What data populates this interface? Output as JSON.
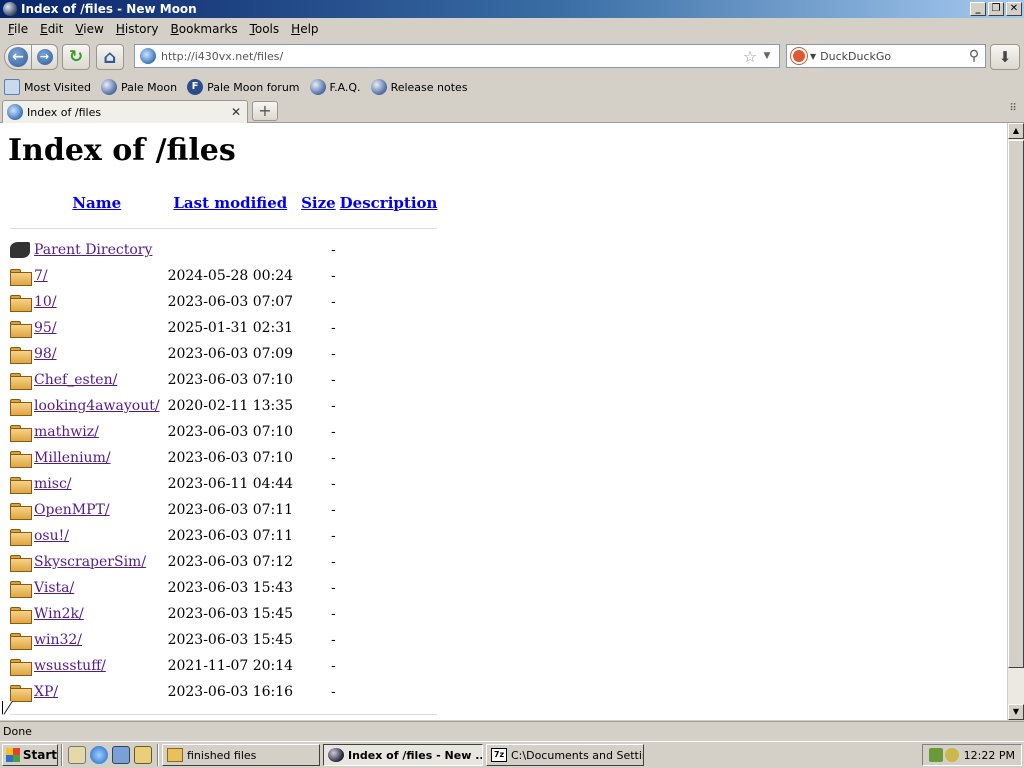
{
  "window": {
    "title": "Index of /files - New Moon",
    "minimize": "_",
    "restore": "❐",
    "close": "✕"
  },
  "menu": {
    "items": [
      {
        "acc": "F",
        "rest": "ile"
      },
      {
        "acc": "E",
        "rest": "dit"
      },
      {
        "acc": "V",
        "rest": "iew"
      },
      {
        "acc": "H",
        "rest": "istory"
      },
      {
        "acc": "B",
        "rest": "ookmarks"
      },
      {
        "acc": "T",
        "rest": "ools"
      },
      {
        "acc": "H",
        "rest": "elp"
      }
    ]
  },
  "nav": {
    "back_glyph": "←",
    "forward_glyph": "→",
    "reload_glyph": "↻",
    "home_glyph": "⌂",
    "url": "http://i430vx.net/files/",
    "star_glyph": "☆",
    "dropdown_glyph": "▼",
    "search_placeholder": "DuckDuckGo",
    "search_engine_drop": "▼",
    "search_glyph": "⚲",
    "download_glyph": "⬇"
  },
  "bookmarks": [
    {
      "label": "Most Visited",
      "icon": "most-visited-icon"
    },
    {
      "label": "Pale Moon",
      "icon": "pale-moon-icon"
    },
    {
      "label": "Pale Moon forum",
      "icon": "forum-icon"
    },
    {
      "label": "F.A.Q.",
      "icon": "pale-moon-icon"
    },
    {
      "label": "Release notes",
      "icon": "pale-moon-icon"
    }
  ],
  "tabs": {
    "active_label": "Index of /files",
    "close_glyph": "✕",
    "new_tab_glyph": "+",
    "list_glyph": "⠿"
  },
  "page": {
    "title": "Index of /files",
    "columns": {
      "name": "Name",
      "modified": "Last modified",
      "size": "Size",
      "description": "Description"
    },
    "parent": {
      "name": "Parent Directory",
      "size": "-"
    },
    "rows": [
      {
        "name": "7/",
        "modified": "2024-05-28 00:24",
        "size": "-"
      },
      {
        "name": "10/",
        "modified": "2023-06-03 07:07",
        "size": "-"
      },
      {
        "name": "95/",
        "modified": "2025-01-31 02:31",
        "size": "-"
      },
      {
        "name": "98/",
        "modified": "2023-06-03 07:09",
        "size": "-"
      },
      {
        "name": "Chef_esten/",
        "modified": "2023-06-03 07:10",
        "size": "-"
      },
      {
        "name": "looking4awayout/",
        "modified": "2020-02-11 13:35",
        "size": "-"
      },
      {
        "name": "mathwiz/",
        "modified": "2023-06-03 07:10",
        "size": "-"
      },
      {
        "name": "Millenium/",
        "modified": "2023-06-03 07:10",
        "size": "-"
      },
      {
        "name": "misc/",
        "modified": "2023-06-11 04:44",
        "size": "-"
      },
      {
        "name": "OpenMPT/",
        "modified": "2023-06-03 07:11",
        "size": "-"
      },
      {
        "name": "osu!/",
        "modified": "2023-06-03 07:11",
        "size": "-"
      },
      {
        "name": "SkyscraperSim/",
        "modified": "2023-06-03 07:12",
        "size": "-"
      },
      {
        "name": "Vista/",
        "modified": "2023-06-03 15:43",
        "size": "-"
      },
      {
        "name": "Win2k/",
        "modified": "2023-06-03 15:45",
        "size": "-"
      },
      {
        "name": "win32/",
        "modified": "2023-06-03 15:45",
        "size": "-"
      },
      {
        "name": "wsusstuff/",
        "modified": "2021-11-07 20:14",
        "size": "-"
      },
      {
        "name": "XP/",
        "modified": "2023-06-03 16:16",
        "size": "-"
      }
    ]
  },
  "scrollbar": {
    "up": "▲",
    "down": "▼"
  },
  "status": {
    "text": "Done"
  },
  "taskbar": {
    "start_label": "Start",
    "tasks": [
      {
        "label": "finished files",
        "icon": "folder",
        "active": false,
        "width": 158
      },
      {
        "label": "Index of /files - New ...",
        "icon": "moon",
        "active": true,
        "width": 160
      },
      {
        "label": "C:\\Documents and Setting...",
        "icon": "zip",
        "active": false,
        "width": 158
      }
    ],
    "clock": "12:22 PM"
  },
  "colors": {
    "link_unvisited": "#0000ee",
    "link_visited": "#551a8b",
    "titlebar": "#0a246a",
    "chrome": "#d4d0c8"
  }
}
